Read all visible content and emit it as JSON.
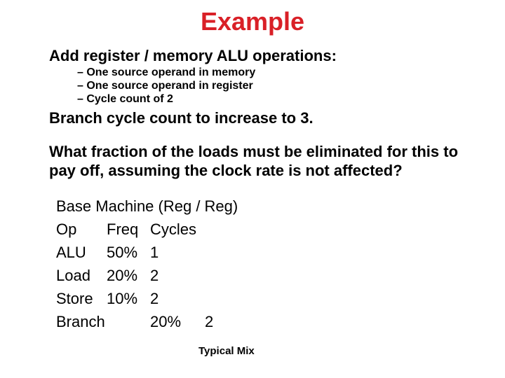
{
  "title": "Example",
  "line1": "Add register / memory ALU operations:",
  "sub1": "– One source operand in memory",
  "sub2": "– One source operand in register",
  "sub3": "– Cycle count of 2",
  "line2": "Branch cycle count to increase to 3.",
  "question": "What fraction of the loads must be eliminated for this to pay off, assuming the clock rate is not affected?",
  "table": {
    "caption": "Base Machine (Reg / Reg)",
    "h_op": "Op",
    "h_freq": "Freq",
    "h_cyc": "Cycles",
    "r1_op": "ALU",
    "r1_freq": "50%",
    "r1_cyc": "1",
    "r2_op": "Load",
    "r2_freq": "20%",
    "r2_cyc": "2",
    "r3_op": "Store",
    "r3_freq": "10%",
    "r3_cyc": "2",
    "r4_op": "Branch",
    "r4_freq": "20%",
    "r4_cyc": "2"
  },
  "footer": "Typical Mix"
}
